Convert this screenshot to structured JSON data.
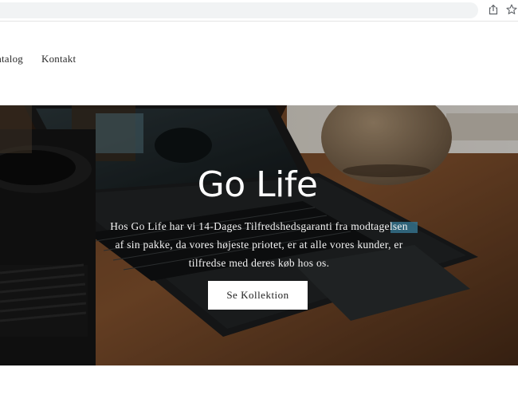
{
  "browser": {
    "share_icon": "share-icon",
    "star_icon": "bookmark-star-icon"
  },
  "nav": {
    "items": [
      {
        "label": "atalog"
      },
      {
        "label": "Kontakt"
      }
    ]
  },
  "hero": {
    "title": "Go Life",
    "text": "Hos Go Life har vi 14-Dages Tilfredshedsgaranti fra modtagelsen af sin pakke, da vores højeste priotet, er at alle vores kunder, er tilfredse med deres køb hos os.",
    "button_label": "Se Kollektion"
  },
  "colors": {
    "text_dark": "#2b2b2b",
    "button_bg": "#ffffff",
    "hero_text": "#ffffff"
  }
}
